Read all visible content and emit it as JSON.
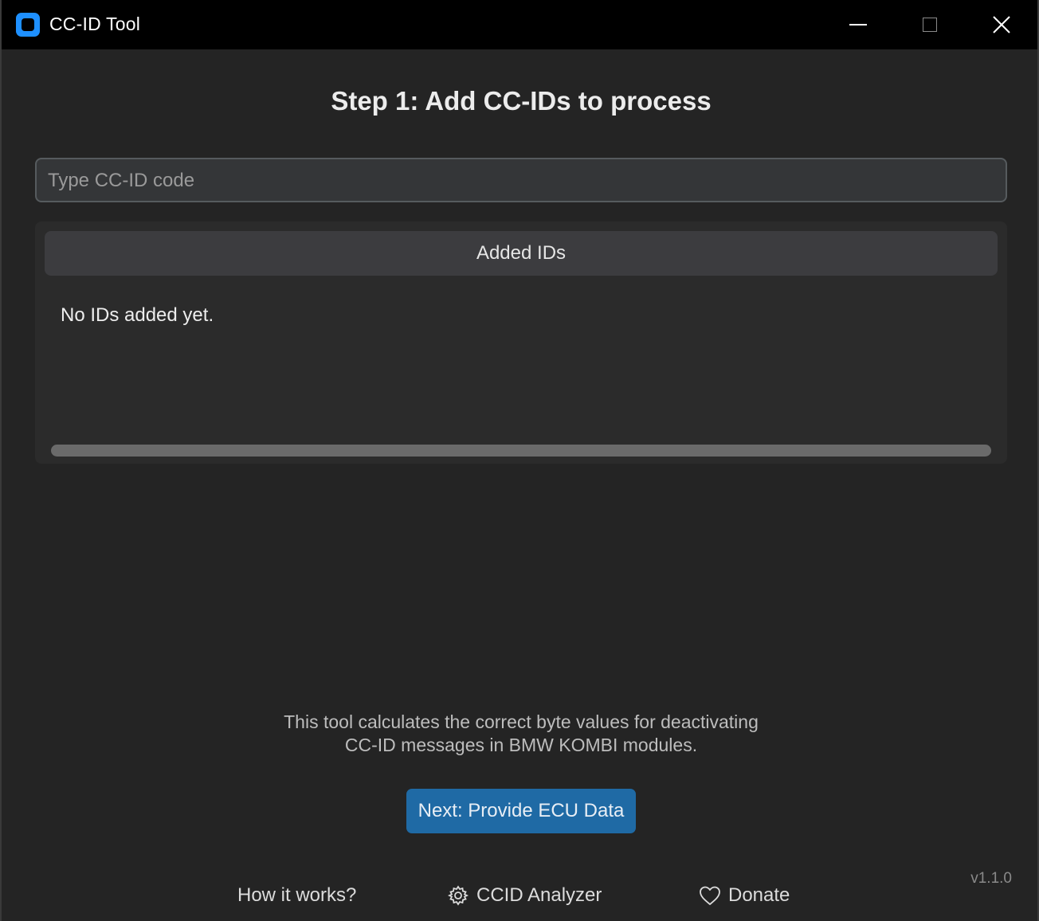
{
  "window": {
    "title": "CC-ID Tool",
    "controls": [
      "minimize",
      "maximize",
      "close"
    ]
  },
  "main": {
    "heading": "Step 1: Add CC-IDs to process",
    "input": {
      "placeholder": "Type CC-ID code",
      "value": ""
    },
    "list": {
      "header": "Added IDs",
      "empty_message": "No IDs added yet.",
      "items": []
    },
    "description_line1": "This tool calculates the correct byte values for deactivating",
    "description_line2": "CC-ID messages in BMW KOMBI modules.",
    "next_button_label": "Next: Provide ECU Data"
  },
  "footer": {
    "version": "v1.1.0",
    "links": {
      "how_it_works": "How it works?",
      "analyzer": {
        "label": "CCID Analyzer",
        "icon": "gear-icon"
      },
      "donate": {
        "label": "Donate",
        "icon": "heart-icon"
      }
    }
  },
  "colors": {
    "accent": "#1f6aa5",
    "app_icon": "#1e90ff",
    "background": "#242424"
  }
}
